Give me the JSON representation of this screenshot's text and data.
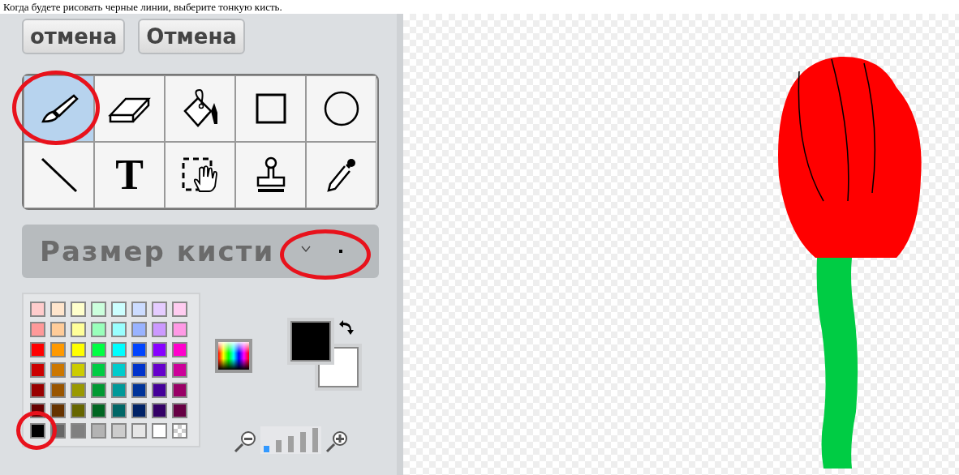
{
  "caption": "Когда будете рисовать черные линии, выберите тонкую кисть.",
  "buttons": [
    "отмена",
    "Отмена"
  ],
  "tools": [
    {
      "kind": "brush",
      "selected": true,
      "highlighted": true
    },
    {
      "kind": "eraser",
      "selected": false,
      "highlighted": false
    },
    {
      "kind": "fill",
      "selected": false,
      "highlighted": false
    },
    {
      "kind": "rectangle",
      "selected": false,
      "highlighted": false
    },
    {
      "kind": "ellipse",
      "selected": false,
      "highlighted": false
    },
    {
      "kind": "line",
      "selected": false,
      "highlighted": false
    },
    {
      "kind": "text",
      "selected": false,
      "highlighted": false
    },
    {
      "kind": "select",
      "selected": false,
      "highlighted": false
    },
    {
      "kind": "stamp",
      "selected": false,
      "highlighted": false
    },
    {
      "kind": "eyedropper",
      "selected": false,
      "highlighted": false
    }
  ],
  "tool_text_glyph": "T",
  "brush_size": {
    "label": "Размер кисти",
    "highlighted": true
  },
  "palette": [
    {
      "color": "#ffcccc",
      "highlighted": false
    },
    {
      "color": "#ffe5cc",
      "highlighted": false
    },
    {
      "color": "#ffffcc",
      "highlighted": false
    },
    {
      "color": "#ccffdd",
      "highlighted": false
    },
    {
      "color": "#ccffff",
      "highlighted": false
    },
    {
      "color": "#ccdcff",
      "highlighted": false
    },
    {
      "color": "#e5ccff",
      "highlighted": false
    },
    {
      "color": "#ffccf0",
      "highlighted": false
    },
    {
      "color": "#ff9999",
      "highlighted": false
    },
    {
      "color": "#ffcc99",
      "highlighted": false
    },
    {
      "color": "#ffff99",
      "highlighted": false
    },
    {
      "color": "#99ffbb",
      "highlighted": false
    },
    {
      "color": "#99ffff",
      "highlighted": false
    },
    {
      "color": "#99b3ff",
      "highlighted": false
    },
    {
      "color": "#cc99ff",
      "highlighted": false
    },
    {
      "color": "#ff99e5",
      "highlighted": false
    },
    {
      "color": "#ff0000",
      "highlighted": false
    },
    {
      "color": "#ff9900",
      "highlighted": false
    },
    {
      "color": "#ffff00",
      "highlighted": false
    },
    {
      "color": "#00ff44",
      "highlighted": false
    },
    {
      "color": "#00ffff",
      "highlighted": false
    },
    {
      "color": "#0044ff",
      "highlighted": false
    },
    {
      "color": "#8800ff",
      "highlighted": false
    },
    {
      "color": "#ff00cc",
      "highlighted": false
    },
    {
      "color": "#cc0000",
      "highlighted": false
    },
    {
      "color": "#cc7700",
      "highlighted": false
    },
    {
      "color": "#cccc00",
      "highlighted": false
    },
    {
      "color": "#00cc44",
      "highlighted": false
    },
    {
      "color": "#00cccc",
      "highlighted": false
    },
    {
      "color": "#0033cc",
      "highlighted": false
    },
    {
      "color": "#6600cc",
      "highlighted": false
    },
    {
      "color": "#cc0099",
      "highlighted": false
    },
    {
      "color": "#990000",
      "highlighted": false
    },
    {
      "color": "#995500",
      "highlighted": false
    },
    {
      "color": "#999900",
      "highlighted": false
    },
    {
      "color": "#009933",
      "highlighted": false
    },
    {
      "color": "#009999",
      "highlighted": false
    },
    {
      "color": "#003399",
      "highlighted": false
    },
    {
      "color": "#440099",
      "highlighted": false
    },
    {
      "color": "#990066",
      "highlighted": false
    },
    {
      "color": "#660000",
      "highlighted": false
    },
    {
      "color": "#663300",
      "highlighted": false
    },
    {
      "color": "#666600",
      "highlighted": false
    },
    {
      "color": "#006622",
      "highlighted": false
    },
    {
      "color": "#006666",
      "highlighted": false
    },
    {
      "color": "#002266",
      "highlighted": false
    },
    {
      "color": "#330066",
      "highlighted": false
    },
    {
      "color": "#660044",
      "highlighted": false
    },
    {
      "color": "#000000",
      "highlighted": true
    },
    {
      "color": "#666666",
      "highlighted": false
    },
    {
      "color": "#808080",
      "highlighted": false
    },
    {
      "color": "#b3b3b3",
      "highlighted": false
    },
    {
      "color": "#cccccc",
      "highlighted": false
    },
    {
      "color": "#e6e6e6",
      "highlighted": false
    },
    {
      "color": "#ffffff",
      "highlighted": false
    },
    {
      "kind": "transparent",
      "highlighted": false
    }
  ],
  "selected_colors": [
    {
      "color": "#000000"
    },
    {
      "color": "#ffffff"
    }
  ],
  "zoom_steps": [
    {
      "selected": true
    },
    {
      "selected": false
    },
    {
      "selected": false
    },
    {
      "selected": false
    },
    {
      "selected": false
    }
  ]
}
